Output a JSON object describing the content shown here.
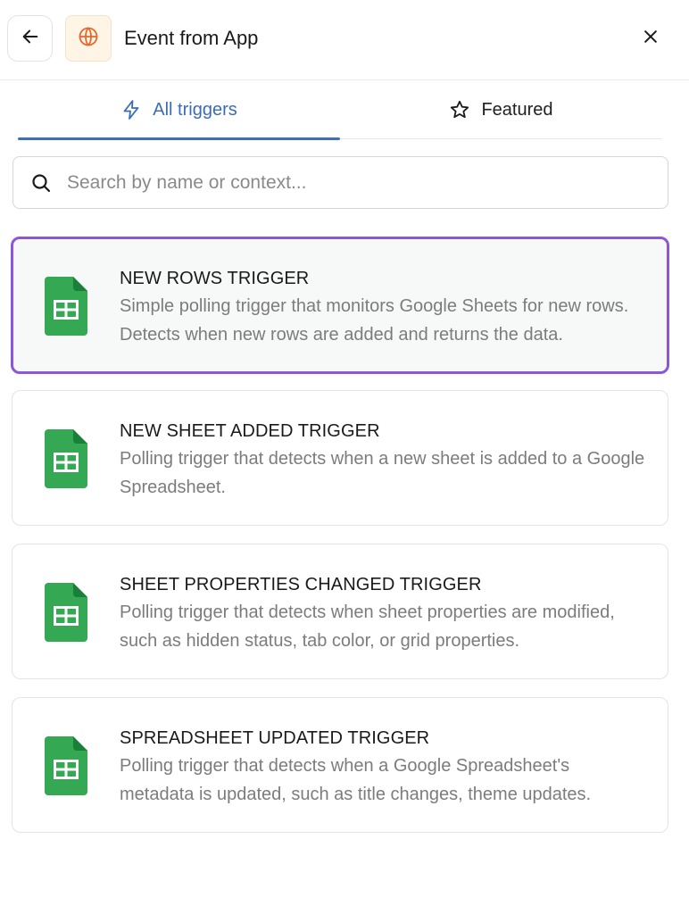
{
  "header": {
    "back_icon": "arrow-left-icon",
    "app_icon": "globe-icon",
    "title": "Event from App",
    "close_icon": "close-icon",
    "app_icon_color": "#e8672a"
  },
  "tabs": [
    {
      "label": "All triggers",
      "icon": "lightning-icon",
      "active": true
    },
    {
      "label": "Featured",
      "icon": "star-icon",
      "active": false
    }
  ],
  "search": {
    "placeholder": "Search by name or context...",
    "value": ""
  },
  "colors": {
    "accent": "#3f6fb6",
    "selected_border": "#8b57d6",
    "sheets_green": "#34a853"
  },
  "triggers": [
    {
      "title": "NEW ROWS TRIGGER",
      "description": "Simple polling trigger that monitors Google Sheets for new rows. Detects when new rows are added and returns the data.",
      "icon": "google-sheets-icon",
      "selected": true
    },
    {
      "title": "NEW SHEET ADDED TRIGGER",
      "description": "Polling trigger that detects when a new sheet is added to a Google Spreadsheet.",
      "icon": "google-sheets-icon",
      "selected": false
    },
    {
      "title": "SHEET PROPERTIES CHANGED TRIGGER",
      "description": "Polling trigger that detects when sheet properties are modified, such as hidden status, tab color, or grid properties.",
      "icon": "google-sheets-icon",
      "selected": false
    },
    {
      "title": "SPREADSHEET UPDATED TRIGGER",
      "description": "Polling trigger that detects when a Google Spreadsheet's metadata is updated, such as title changes, theme updates.",
      "icon": "google-sheets-icon",
      "selected": false
    }
  ]
}
